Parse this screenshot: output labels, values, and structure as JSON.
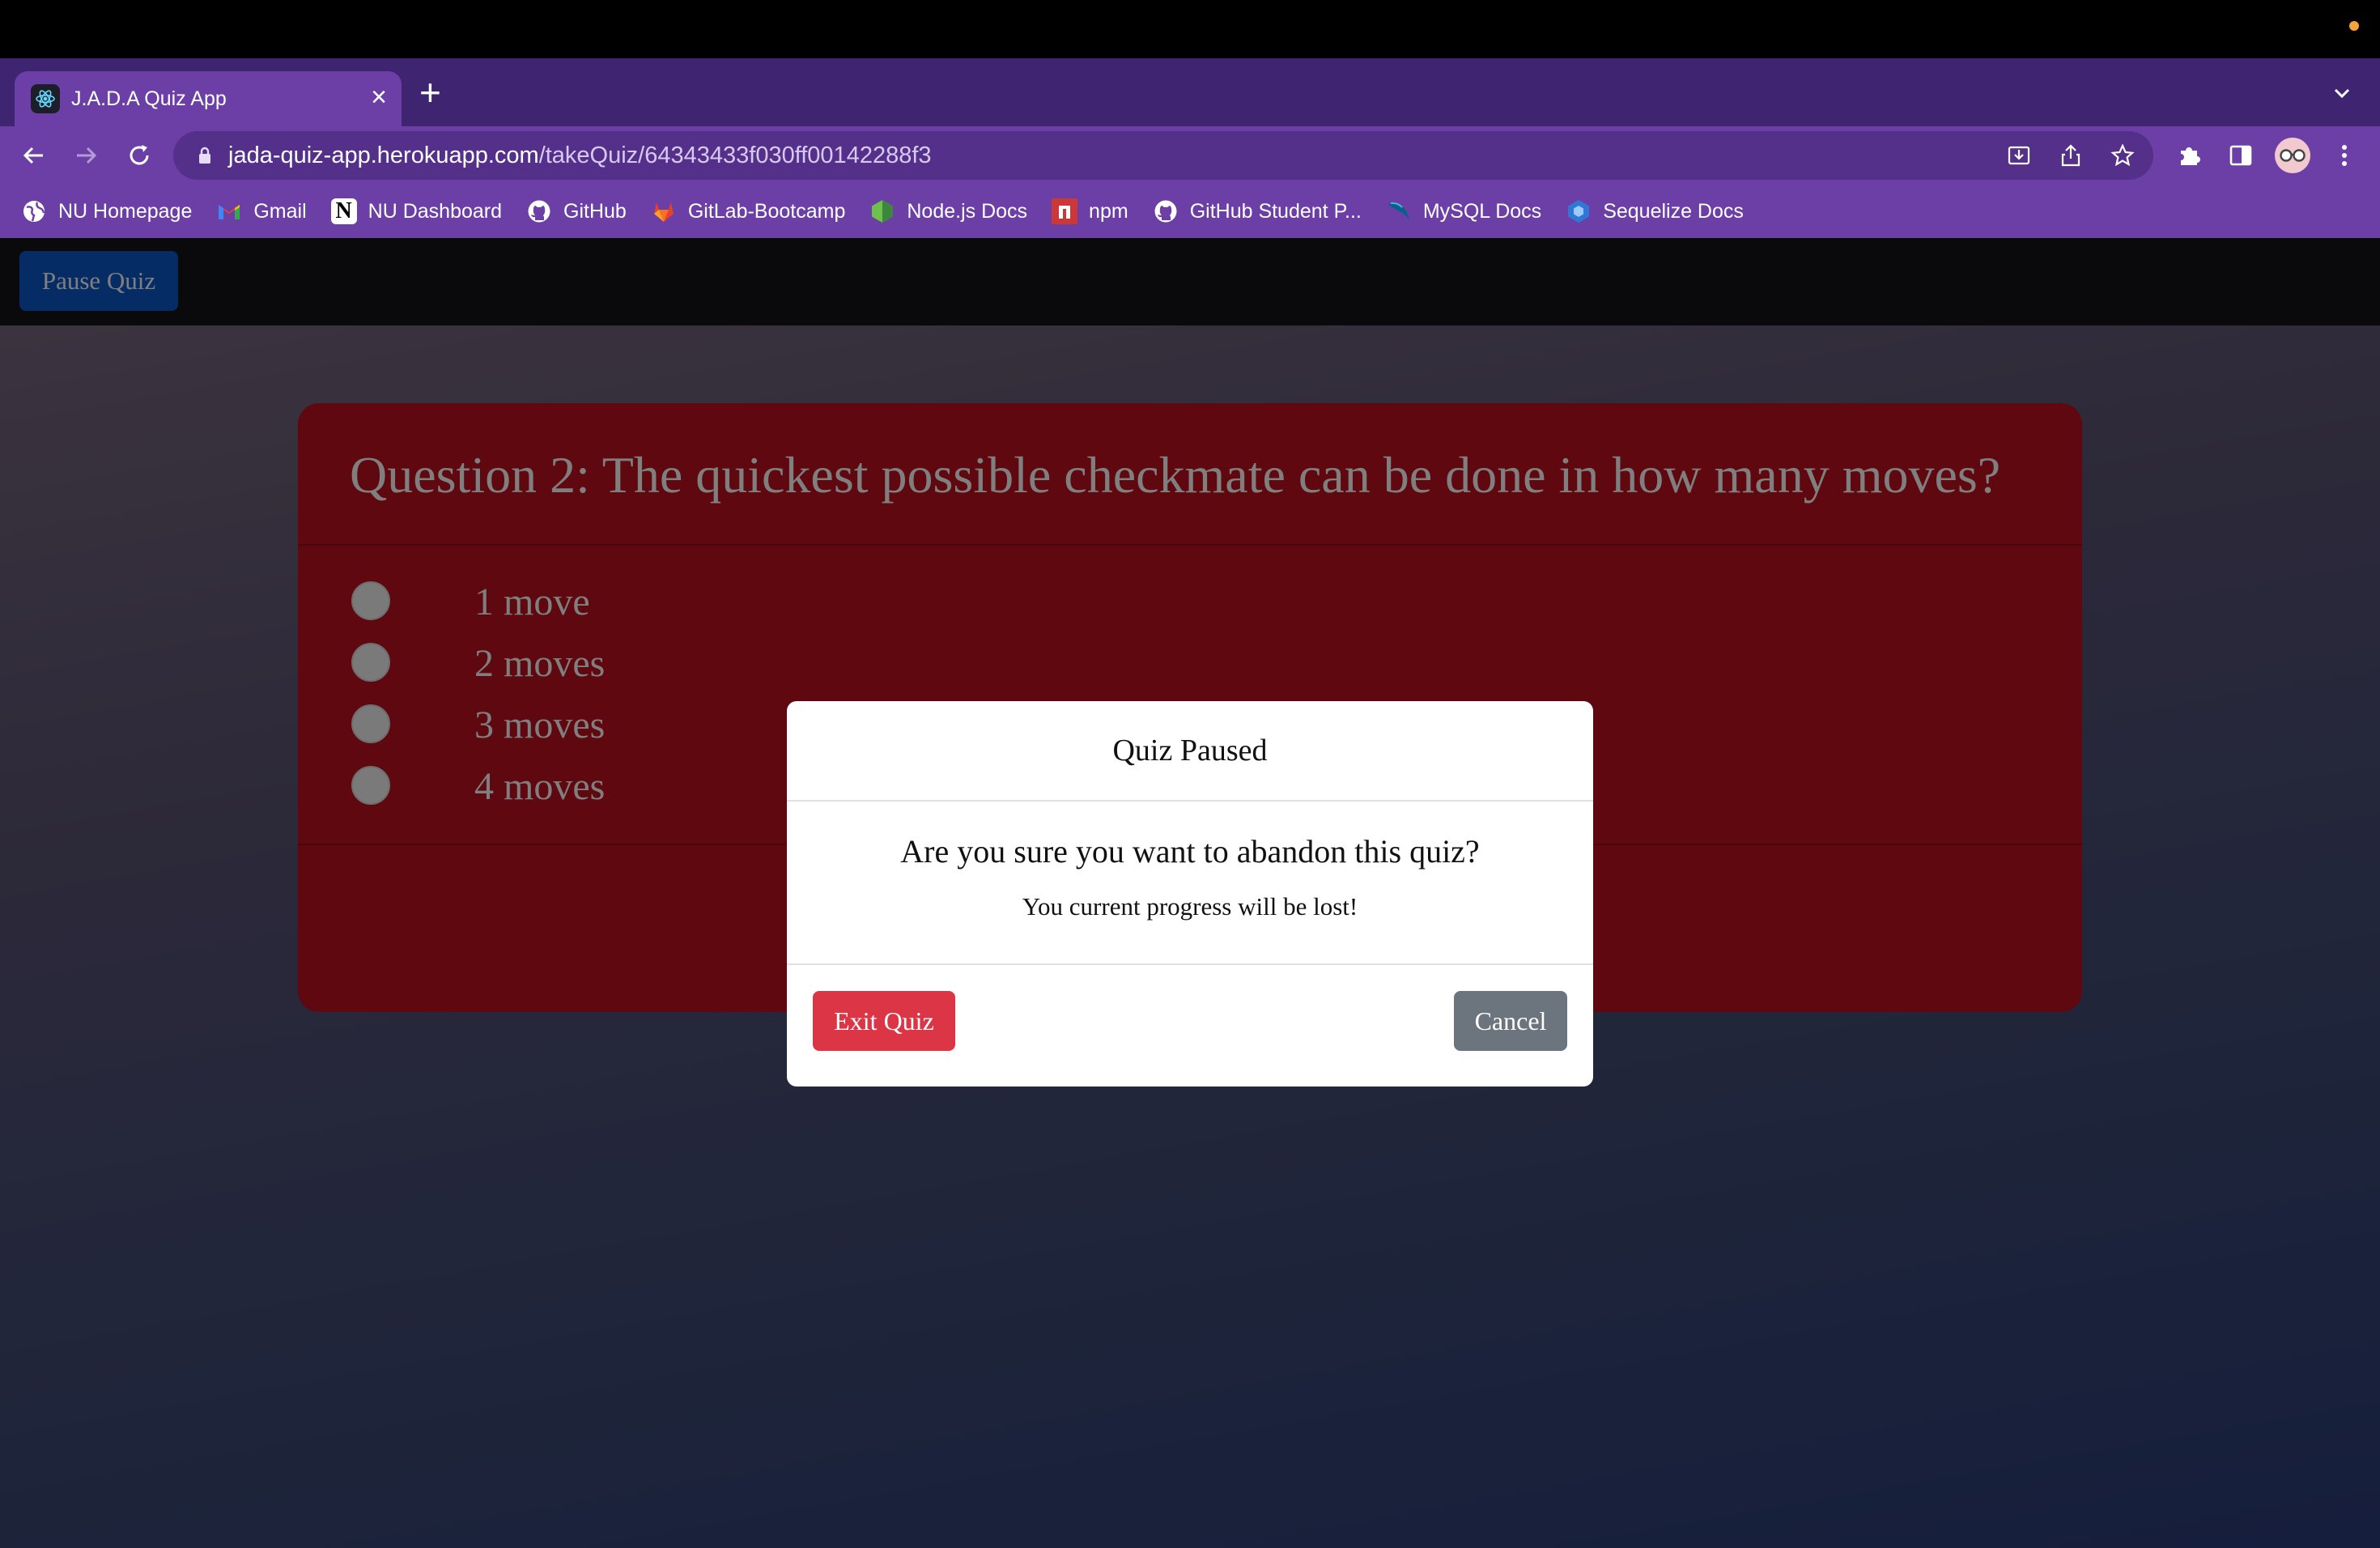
{
  "browser": {
    "tab": {
      "title": "J.A.D.A Quiz App",
      "favicon": "react-atom-icon",
      "close_glyph": "×"
    },
    "new_tab_glyph": "+",
    "url": {
      "host": "jada-quiz-app.herokuapp.com",
      "path": "/takeQuiz/64343433f030ff00142288f3"
    },
    "bookmarks": [
      {
        "label": "NU Homepage",
        "icon": "globe-icon"
      },
      {
        "label": "Gmail",
        "icon": "gmail-icon"
      },
      {
        "label": "NU Dashboard",
        "icon": "notion-icon"
      },
      {
        "label": "GitHub",
        "icon": "github-icon"
      },
      {
        "label": "GitLab-Bootcamp",
        "icon": "gitlab-icon"
      },
      {
        "label": "Node.js Docs",
        "icon": "nodejs-icon"
      },
      {
        "label": "npm",
        "icon": "npm-icon"
      },
      {
        "label": "GitHub Student P...",
        "icon": "github-icon"
      },
      {
        "label": "MySQL Docs",
        "icon": "mysql-icon"
      },
      {
        "label": "Sequelize Docs",
        "icon": "sequelize-icon"
      }
    ]
  },
  "app": {
    "pause_button": "Pause Quiz",
    "question": "Question 2: The quickest possible checkmate can be done in how many moves?",
    "options": [
      "1 move",
      "2 moves",
      "3 moves",
      "4 moves"
    ]
  },
  "modal": {
    "title": "Quiz Paused",
    "question": "Are you sure you want to abandon this quiz?",
    "warning": "You current progress will be lost!",
    "exit_button": "Exit Quiz",
    "cancel_button": "Cancel"
  },
  "colors": {
    "chrome_purple": "#6b3fa6",
    "quiz_card": "#c0101f",
    "exit_red": "#dc3545",
    "cancel_gray": "#6c757d",
    "pause_blue": "#0a58ca"
  }
}
